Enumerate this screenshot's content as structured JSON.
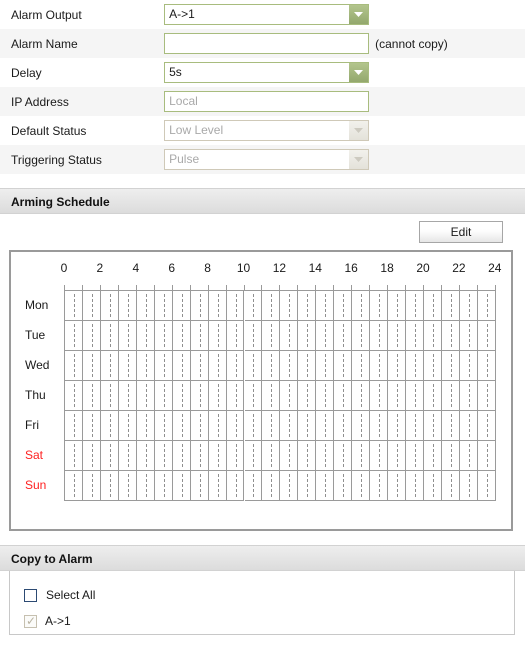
{
  "form": {
    "rows": [
      {
        "label": "Alarm Output",
        "type": "select",
        "value": "A->1",
        "disabled": false,
        "note": ""
      },
      {
        "label": "Alarm Name",
        "type": "text",
        "value": "",
        "placeholder": "",
        "disabled": false,
        "note": "(cannot copy)"
      },
      {
        "label": "Delay",
        "type": "select",
        "value": "5s",
        "disabled": false,
        "note": ""
      },
      {
        "label": "IP Address",
        "type": "text",
        "value": "",
        "placeholder": "Local",
        "disabled": false,
        "note": ""
      },
      {
        "label": "Default Status",
        "type": "select",
        "value": "Low Level",
        "disabled": true,
        "note": ""
      },
      {
        "label": "Triggering Status",
        "type": "select",
        "value": "Pulse",
        "disabled": true,
        "note": ""
      }
    ]
  },
  "arming_schedule": {
    "section_title": "Arming Schedule",
    "edit_button": "Edit",
    "hour_labels": [
      "0",
      "2",
      "4",
      "6",
      "8",
      "10",
      "12",
      "14",
      "16",
      "18",
      "20",
      "22",
      "24"
    ],
    "days": [
      {
        "label": "Mon",
        "weekend": false
      },
      {
        "label": "Tue",
        "weekend": false
      },
      {
        "label": "Wed",
        "weekend": false
      },
      {
        "label": "Thu",
        "weekend": false
      },
      {
        "label": "Fri",
        "weekend": false
      },
      {
        "label": "Sat",
        "weekend": true
      },
      {
        "label": "Sun",
        "weekend": true
      }
    ],
    "hours_total": 24,
    "segments": []
  },
  "copy_to_alarm": {
    "section_title": "Copy to Alarm",
    "select_all_label": "Select All",
    "items": [
      {
        "label": "A->1",
        "checked": true,
        "disabled": true
      }
    ]
  },
  "colors": {
    "accent_green": "#a8bc7e",
    "weekend_red": "#ff1f1f",
    "grid_line": "#9a9a9a",
    "row_alt": "#f5f5f5"
  }
}
